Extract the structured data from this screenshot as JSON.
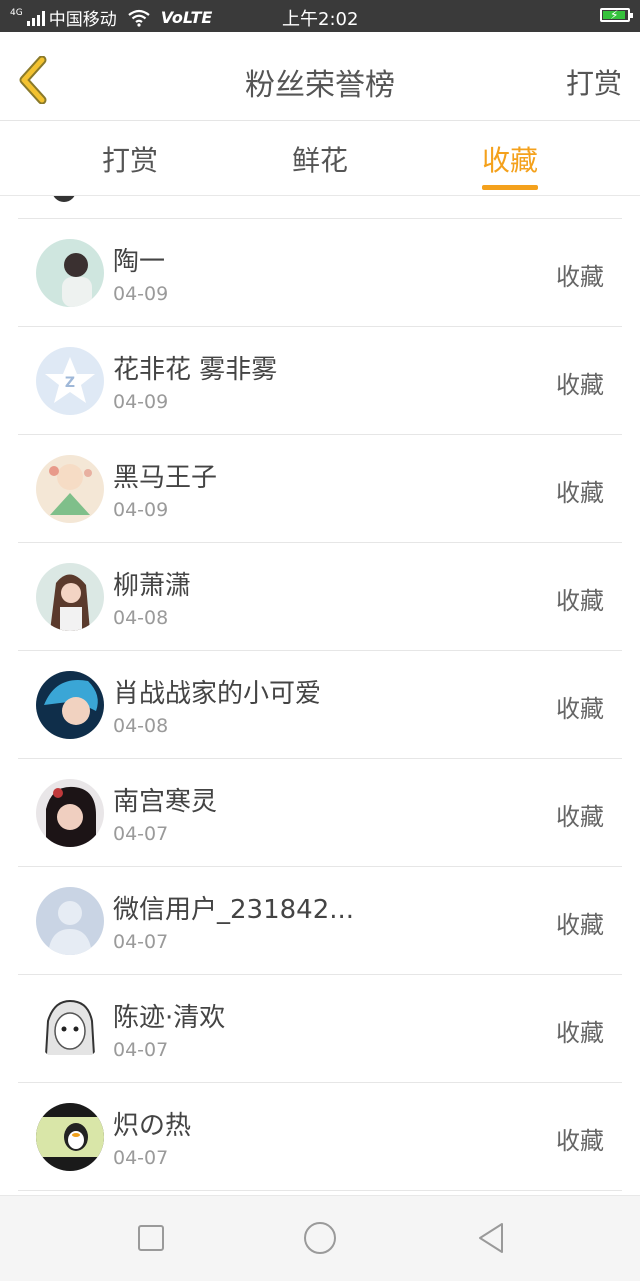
{
  "status": {
    "network_type": "4G",
    "carrier": "中国移动",
    "volte": "VoLTE",
    "time": "上午2:02"
  },
  "header": {
    "title": "粉丝荣誉榜",
    "action": "打赏"
  },
  "tabs": [
    {
      "label": "打赏",
      "active": false
    },
    {
      "label": "鲜花",
      "active": false
    },
    {
      "label": "收藏",
      "active": true
    }
  ],
  "colors": {
    "accent": "#f4a11c",
    "status_bar": "#3a3a3a",
    "battery": "#35c13c"
  },
  "list": [
    {
      "name": "陶一",
      "date": "04-09",
      "action": "收藏",
      "avatar": "photo-girl-avatar"
    },
    {
      "name": "花非花 雾非雾",
      "date": "04-09",
      "action": "收藏",
      "avatar": "qq-default-avatar"
    },
    {
      "name": "黑马王子",
      "date": "04-09",
      "action": "收藏",
      "avatar": "illustration-avatar"
    },
    {
      "name": "柳萧潇",
      "date": "04-08",
      "action": "收藏",
      "avatar": "photo-girl-avatar"
    },
    {
      "name": "肖战战家的小可爱",
      "date": "04-08",
      "action": "收藏",
      "avatar": "blue-hair-avatar"
    },
    {
      "name": "南宫寒灵",
      "date": "04-07",
      "action": "收藏",
      "avatar": "dark-photo-avatar"
    },
    {
      "name": "微信用户_231842...",
      "date": "04-07",
      "action": "收藏",
      "avatar": "default-person-avatar"
    },
    {
      "name": "陈迹·清欢",
      "date": "04-07",
      "action": "收藏",
      "avatar": "sketch-avatar"
    },
    {
      "name": "炽の热",
      "date": "04-07",
      "action": "收藏",
      "avatar": "penguin-avatar"
    }
  ]
}
